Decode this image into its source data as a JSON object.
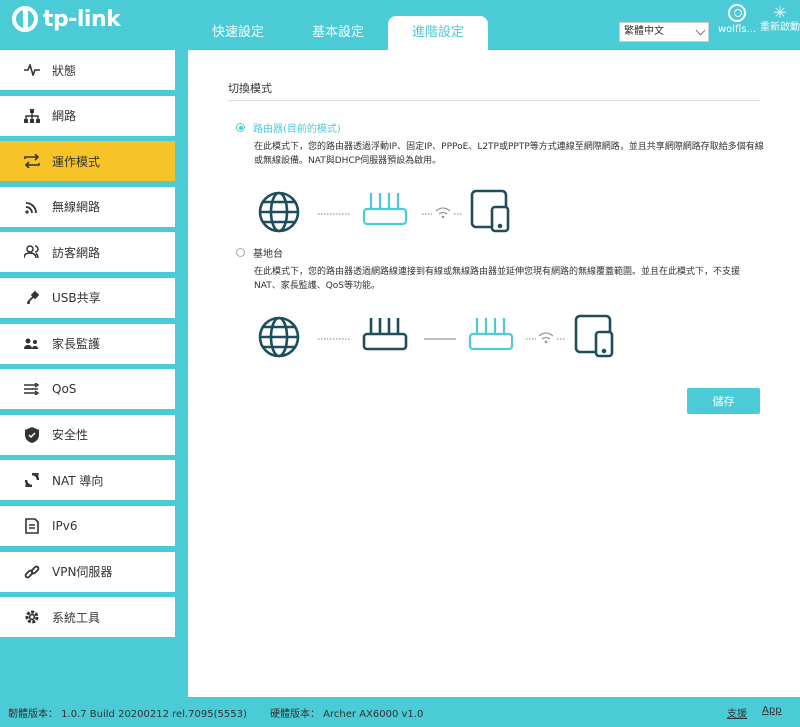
{
  "header": {
    "logo": "tp-link",
    "tabs": [
      {
        "label": "快速設定"
      },
      {
        "label": "基本設定"
      },
      {
        "label": "進階設定"
      }
    ],
    "language": "繁體中文",
    "user": "wolfls...",
    "reboot": "重新啟動"
  },
  "sidebar": {
    "items": [
      {
        "label": "狀態",
        "icon": "pulse-icon"
      },
      {
        "label": "網路",
        "icon": "network-icon"
      },
      {
        "label": "運作模式",
        "icon": "switch-mode-icon"
      },
      {
        "label": "無線網路",
        "icon": "wifi-icon"
      },
      {
        "label": "訪客網路",
        "icon": "guest-icon"
      },
      {
        "label": "USB共享",
        "icon": "usb-icon"
      },
      {
        "label": "家長監護",
        "icon": "parental-icon"
      },
      {
        "label": "QoS",
        "icon": "qos-icon"
      },
      {
        "label": "安全性",
        "icon": "shield-icon"
      },
      {
        "label": "NAT 導向",
        "icon": "nat-icon"
      },
      {
        "label": "IPv6",
        "icon": "ipv6-icon"
      },
      {
        "label": "VPN伺服器",
        "icon": "link-icon"
      },
      {
        "label": "系統工具",
        "icon": "gear-icon"
      }
    ]
  },
  "main": {
    "section_title": "切換模式",
    "router_mode": {
      "label": "路由器(目前的模式)",
      "description": "在此模式下，您的路由器透過浮動IP、固定IP、PPPoE、L2TP或PPTP等方式連線至網際網路，並且共享網際網路存取給多個有線或無線設備。NAT與DHCP伺服器預設為啟用。"
    },
    "ap_mode": {
      "label": "基地台",
      "description": "在此模式下，您的路由器透過網路線連接到有線或無線路由器並延伸您現有網路的無線覆蓋範圍。並且在此模式下，不支援NAT、家長監護、QoS等功能。"
    },
    "save_label": "儲存"
  },
  "footer": {
    "firmware": "韌體版本： 1.0.7 Build 20200212 rel.7095(5553)",
    "hardware": "硬體版本： Archer AX6000 v1.0",
    "support": "支援",
    "app": "App"
  },
  "colors": {
    "accent": "#4acbd6",
    "active_nav": "#f6c426",
    "icon_dark": "#1e4d5c"
  }
}
